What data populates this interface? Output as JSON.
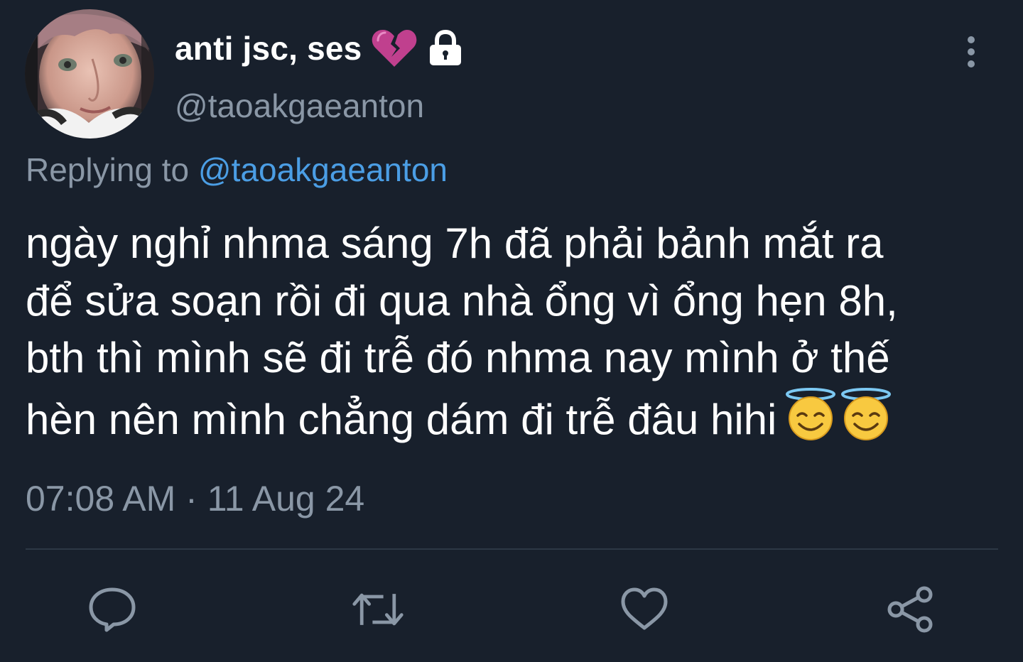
{
  "author": {
    "display_name": "anti jsc, ses",
    "name_emoji": "broken-heart-icon",
    "protected_icon": "lock-icon",
    "handle": "@taoakgaeanton",
    "avatar": "profile-photo"
  },
  "reply": {
    "prefix": "Replying to",
    "mention": "@taoakgaeanton"
  },
  "tweet": {
    "lines": [
      "ngày nghỉ nhma sáng 7h đã phải bảnh mắt ra",
      "để sửa soạn rồi đi qua nhà ổng vì ổng hẹn 8h,",
      "bth thì mình sẽ đi trễ đó nhma nay mình ở thế",
      "hèn nên mình chẳng dám đi trễ đâu hihi"
    ],
    "trailing_emoji": [
      "smiling-face-with-halo-icon",
      "smiling-face-with-halo-icon"
    ],
    "timestamp": "07:08 AM · 11 Aug 24"
  },
  "actions": [
    "reply-icon",
    "retweet-icon",
    "like-icon",
    "share-icon"
  ],
  "menu_icon": "more-vertical-icon",
  "colors": {
    "background": "#18202c",
    "primary_text": "#ffffff",
    "secondary_text": "#8a97a6",
    "link": "#4b9ee5",
    "divider": "#2d3845",
    "icon": "#8a97a6"
  }
}
